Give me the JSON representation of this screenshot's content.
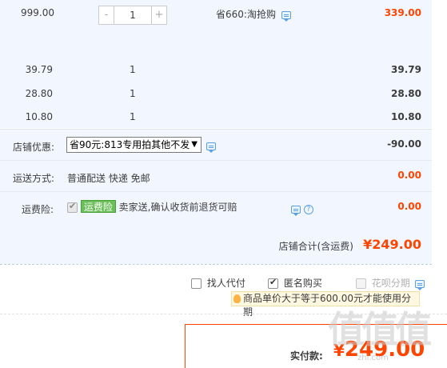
{
  "items": [
    {
      "unit_price": "999.00",
      "quantity": "1",
      "promo": "省660:淘抢购",
      "amount": "339.00"
    },
    {
      "unit_price": "39.79",
      "quantity": "1",
      "amount": "39.79"
    },
    {
      "unit_price": "28.80",
      "quantity": "1",
      "amount": "28.80"
    },
    {
      "unit_price": "10.80",
      "quantity": "1",
      "amount": "10.80"
    }
  ],
  "stepper": {
    "minus": "-",
    "plus": "+"
  },
  "discount": {
    "label": "店铺优惠:",
    "selected": "省90元:813专用拍其他不发",
    "arrow": "▼",
    "amount": "-90.00"
  },
  "shipping": {
    "label": "运送方式:",
    "value": "普通配送 快递 免邮",
    "amount": "0.00"
  },
  "insurance": {
    "label": "运费险:",
    "tag": "运费险",
    "desc": "卖家送,确认收货前退货可赔",
    "help": "?",
    "amount": "0.00"
  },
  "store_total": {
    "label": "店铺合计(含运费)",
    "value": "¥249.00"
  },
  "options": {
    "proxy_pay": "找人代付",
    "anonymous": "匿名购买",
    "installment": "花呗分期"
  },
  "notice": "商品单价大于等于600.00元才能使用分期",
  "payment": {
    "label": "实付款:",
    "currency": "¥",
    "value": "249.00"
  },
  "watermark": {
    "main": "值值值",
    "sub": "zhi.com"
  },
  "colors": {
    "price_red": "#ff4400",
    "row_bg": "#f2f7ff",
    "insurance_tag": "#6abf59"
  }
}
